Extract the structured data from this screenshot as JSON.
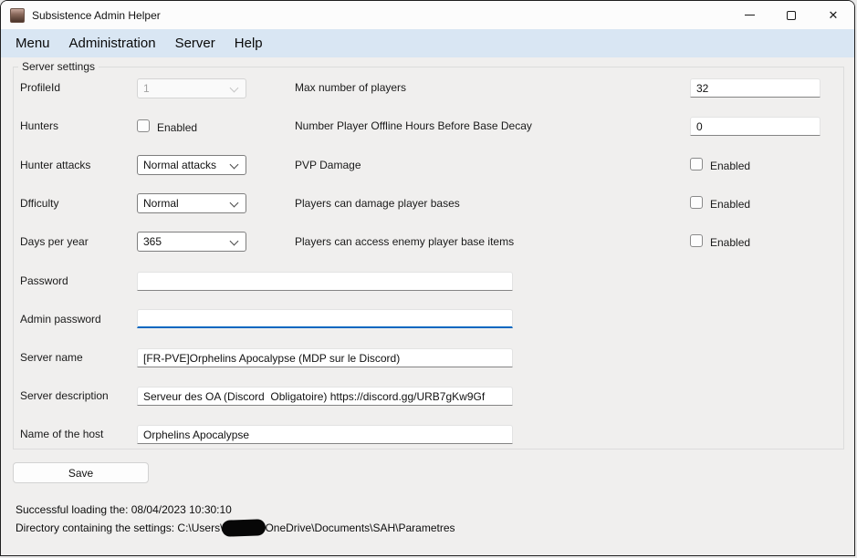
{
  "window": {
    "title": "Subsistence Admin Helper",
    "close_glyph": "✕"
  },
  "menu": {
    "items": [
      {
        "label": "Menu"
      },
      {
        "label": "Administration"
      },
      {
        "label": "Server"
      },
      {
        "label": "Help"
      }
    ]
  },
  "group": {
    "title": "Server settings"
  },
  "fields": {
    "profile_id": {
      "label": "ProfileId",
      "value": "1",
      "disabled": true
    },
    "max_players": {
      "label": "Max number of players",
      "value": "32"
    },
    "hunters": {
      "label": "Hunters",
      "checkbox_label": "Enabled",
      "checked": false
    },
    "offline_decay": {
      "label": "Number Player Offline Hours Before Base Decay",
      "value": "0"
    },
    "hunter_attacks": {
      "label": "Hunter attacks",
      "value": "Normal attacks"
    },
    "pvp_damage": {
      "label": "PVP Damage",
      "checkbox_label": "Enabled",
      "checked": false
    },
    "difficulty": {
      "label": "Dfficulty",
      "value": "Normal"
    },
    "damage_bases": {
      "label": "Players can damage player bases",
      "checkbox_label": "Enabled",
      "checked": false
    },
    "days_per_year": {
      "label": "Days per year",
      "value": "365"
    },
    "access_enemy_items": {
      "label": "Players can access enemy player base items",
      "checkbox_label": "Enabled",
      "checked": false
    },
    "password": {
      "label": "Password",
      "value": ""
    },
    "admin_password": {
      "label": "Admin password",
      "value": "",
      "focused": true
    },
    "server_name": {
      "label": "Server name",
      "value": "[FR-PVE]Orphelins Apocalypse (MDP sur le Discord)"
    },
    "server_description": {
      "label": "Server description",
      "value": "Serveur des OA (Discord  Obligatoire) https://discord.gg/URB7gKw9Gf"
    },
    "host_name": {
      "label": "Name of the host",
      "value": "Orphelins Apocalypse"
    }
  },
  "save_button": {
    "label": "Save"
  },
  "status": {
    "line1": "Successful loading the: 08/04/2023 10:30:10",
    "line2_prefix": "Directory containing the settings: C:\\Users\\",
    "line2_suffix": "OneDrive\\Documents\\SAH\\Parametres"
  },
  "colors": {
    "accent_focus": "#0067c0",
    "menubar_bg": "#d9e6f3",
    "redaction": "#000000"
  }
}
